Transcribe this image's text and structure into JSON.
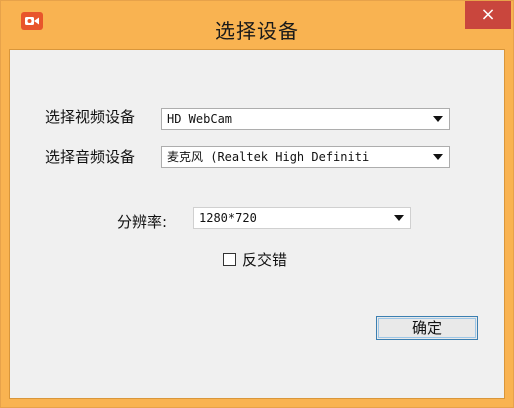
{
  "window": {
    "title": "选择设备",
    "close_symbol": "×",
    "icon": "camera-app-icon"
  },
  "form": {
    "video_label": "选择视频设备",
    "video_value": "HD WebCam",
    "audio_label": "选择音频设备",
    "audio_value": "麦克风 (Realtek High Definiti",
    "resolution_label": "分辨率:",
    "resolution_value": "1280*720",
    "deinterlace_label": "反交错",
    "deinterlace_checked": false,
    "ok_label": "确定"
  },
  "colors": {
    "frame": "#f9b351",
    "close_button": "#c9463d",
    "app_icon": "#e8552b",
    "client_bg": "#f0f0f0"
  }
}
